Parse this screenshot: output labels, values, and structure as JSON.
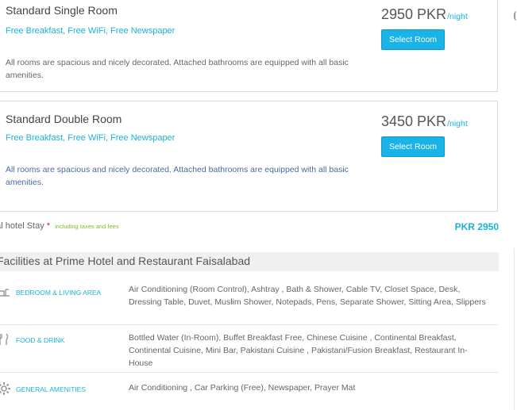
{
  "rooms": [
    {
      "name": "Standard Single Room",
      "amenities": "Free Breakfast, Free WiFi, Free Newspaper",
      "description": "All rooms are spacious and nicely decorated. Attached bathrooms are equipped with all basic amenities.",
      "price": "2950 PKR",
      "unit": "/night",
      "button": "Select Room"
    },
    {
      "name": "Standard Double Room",
      "amenities": "Free Breakfast, Free WiFi, Free Newspaper",
      "description": "All rooms are spacious and nicely decorated. Attached bathrooms are equipped with all basic amenities.",
      "price": "3450 PKR",
      "unit": "/night",
      "button": "Select Room"
    }
  ],
  "total": {
    "label": "otal hotel Stay",
    "star": "*",
    "note": "including taxes and fees",
    "amount": "PKR 2950"
  },
  "facilities": {
    "title": "Facilities at Prime Hotel and Restaurant Faisalabad",
    "groups": [
      {
        "icon": "sofa-icon",
        "name": "BEDROOM & LIVING AREA",
        "items": "Air Conditioning (Room Control), Ashtray , Bath & Shower, Cable TV, Closet Space, Desk, Dressing Table, Duvet, Muslim Shower, Notepads, Pens, Separate Shower, Sitting Area, Slippers"
      },
      {
        "icon": "utensils-icon",
        "name": "FOOD & DRINK",
        "items": "Bottled Water (In-Room), Buffet Breakfast Free, Chinese Cuisine , Continental Breakfast, Continental Cuisine, Mini Bar, Pakistani Cuisine , Pakistani/Fusion Breakfast, Restaurant In-House"
      },
      {
        "icon": "gear-icon",
        "name": "GENERAL AMENITIES",
        "items": "Air Conditioning , Car Parking (Free), Newspaper, Prayer Mat"
      }
    ]
  },
  "colors": {
    "accent": "#1ab3d8",
    "button": "#1ab3e8",
    "note_green": "#7dbf2a",
    "star_red": "#e02020"
  }
}
